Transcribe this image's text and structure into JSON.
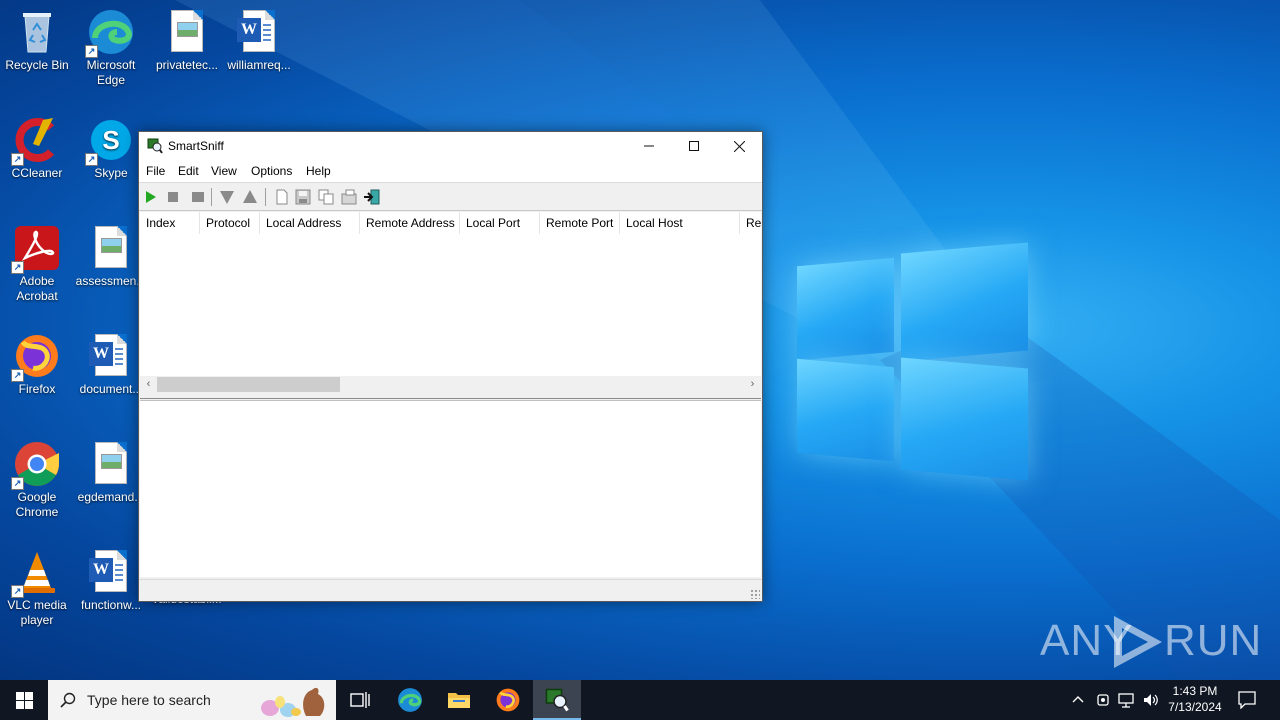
{
  "desktop": {
    "icons": [
      {
        "label": "Recycle Bin"
      },
      {
        "label": "Microsoft Edge"
      },
      {
        "label": "privatetec..."
      },
      {
        "label": "williamreq..."
      },
      {
        "label": "CCleaner"
      },
      {
        "label": "Skype"
      },
      {
        "label": "Adobe Acrobat"
      },
      {
        "label": "assessmen..."
      },
      {
        "label": "Firefox"
      },
      {
        "label": "document..."
      },
      {
        "label": "Google Chrome"
      },
      {
        "label": "egdemand..."
      },
      {
        "label": "VLC media player"
      },
      {
        "label": "functionw..."
      },
      {
        "label": "validestabli..."
      }
    ]
  },
  "window": {
    "title": "SmartSniff",
    "menu": [
      "File",
      "Edit",
      "View",
      "Options",
      "Help"
    ],
    "columns": [
      "Index",
      "Protocol",
      "Local Address",
      "Remote Address",
      "Local Port",
      "Remote Port",
      "Local Host",
      "Rem"
    ],
    "colors": {
      "start": "#22a822",
      "stop": "#8a8a8a"
    }
  },
  "watermark": {
    "left": "ANY",
    "right": "RUN"
  },
  "taskbar": {
    "search_placeholder": "Type here to search",
    "time": "1:43 PM",
    "date": "7/13/2024"
  }
}
